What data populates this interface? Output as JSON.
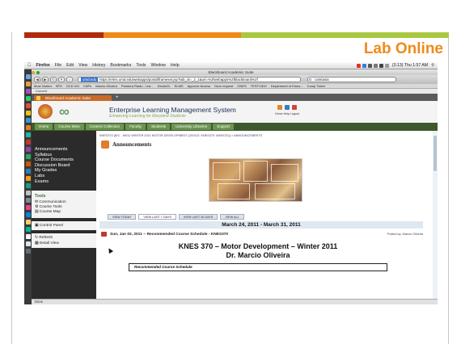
{
  "slide": {
    "title": "Lab Online"
  },
  "mac_menu": {
    "app": "Firefox",
    "items": [
      "File",
      "Edit",
      "View",
      "History",
      "Bookmarks",
      "Tools",
      "Window",
      "Help"
    ],
    "clock": "(3:13)  Thu 1:57 AM"
  },
  "browser": {
    "window_title": "Blackboard Academic Suite",
    "url_host": "umd.edu",
    "url_path": "https://elms.umd.edu/webapps/portal/frameset.jsp?tab_id=_2_1&url=%2fwebapps%2fblackboard%2f",
    "search_value": "camtasia",
    "bookmarks": [
      "Most Visited",
      "SPH",
      "DCD VIII",
      "CNPs",
      "Marcio Oliveira",
      "Pandora Radio - List...",
      "Desire2L",
      "ELMS",
      "Approve Access",
      "Dear request",
      "GNES",
      "TESTVIDO",
      "Department of Kines...",
      "Comp Ticket"
    ],
    "convert_label": "Convert",
    "tab_label": "Blackboard Academic Suite",
    "status": "Done"
  },
  "blackboard": {
    "title": "Enterprise Learning Management System",
    "subtitle": "Enhancing Learning for Maryland Students",
    "header_links": "Home  Help  Logout",
    "nav_tabs": [
      "Home",
      "Course Sites",
      "Content Collection",
      "Faculty",
      "Students",
      "University Libraries",
      "Support"
    ],
    "menu": [
      "Announcements",
      "Syllabus",
      "Course Documents",
      "Discussion Board",
      "My Grades",
      "Labs",
      "Exams"
    ],
    "tools_heading": "Tools",
    "tools": [
      "Communication",
      "Course Tools",
      "Course Map"
    ],
    "control_panel": "Control Panel",
    "refresh": "Refresh",
    "detail_view": "Detail View"
  },
  "content": {
    "breadcrumb": "KNES370 (B/C - W011 WINTER 2011 MOTOR DEVELOPMENT (201012: KNES370: MARCIO)) > ANNOUNCEMENTS",
    "page_title": "Announcements",
    "view_tabs": [
      "VIEW TODAY",
      "VIEW LAST 7 DAYS",
      "VIEW LAST 30 DAYS",
      "VIEW ALL"
    ],
    "date_range": "March 24, 2011 - March 31, 2011",
    "post_line": "Sun, Jan 02, 2011 -- Recommended Course Schedule - KNES370",
    "posted_by": "Posted by: Marcio Oliveira",
    "course_title": "KNES 370 – Motor Development – Winter 2011",
    "instructor": "Dr. Marcio Oliveira",
    "schedule_header": "Recommended Course Schedule"
  },
  "colors": {
    "slide_red": "#b02a0e",
    "slide_orange": "#ee8a1a",
    "slide_green": "#a9c840",
    "bb_nav": "#3d5a2e"
  }
}
